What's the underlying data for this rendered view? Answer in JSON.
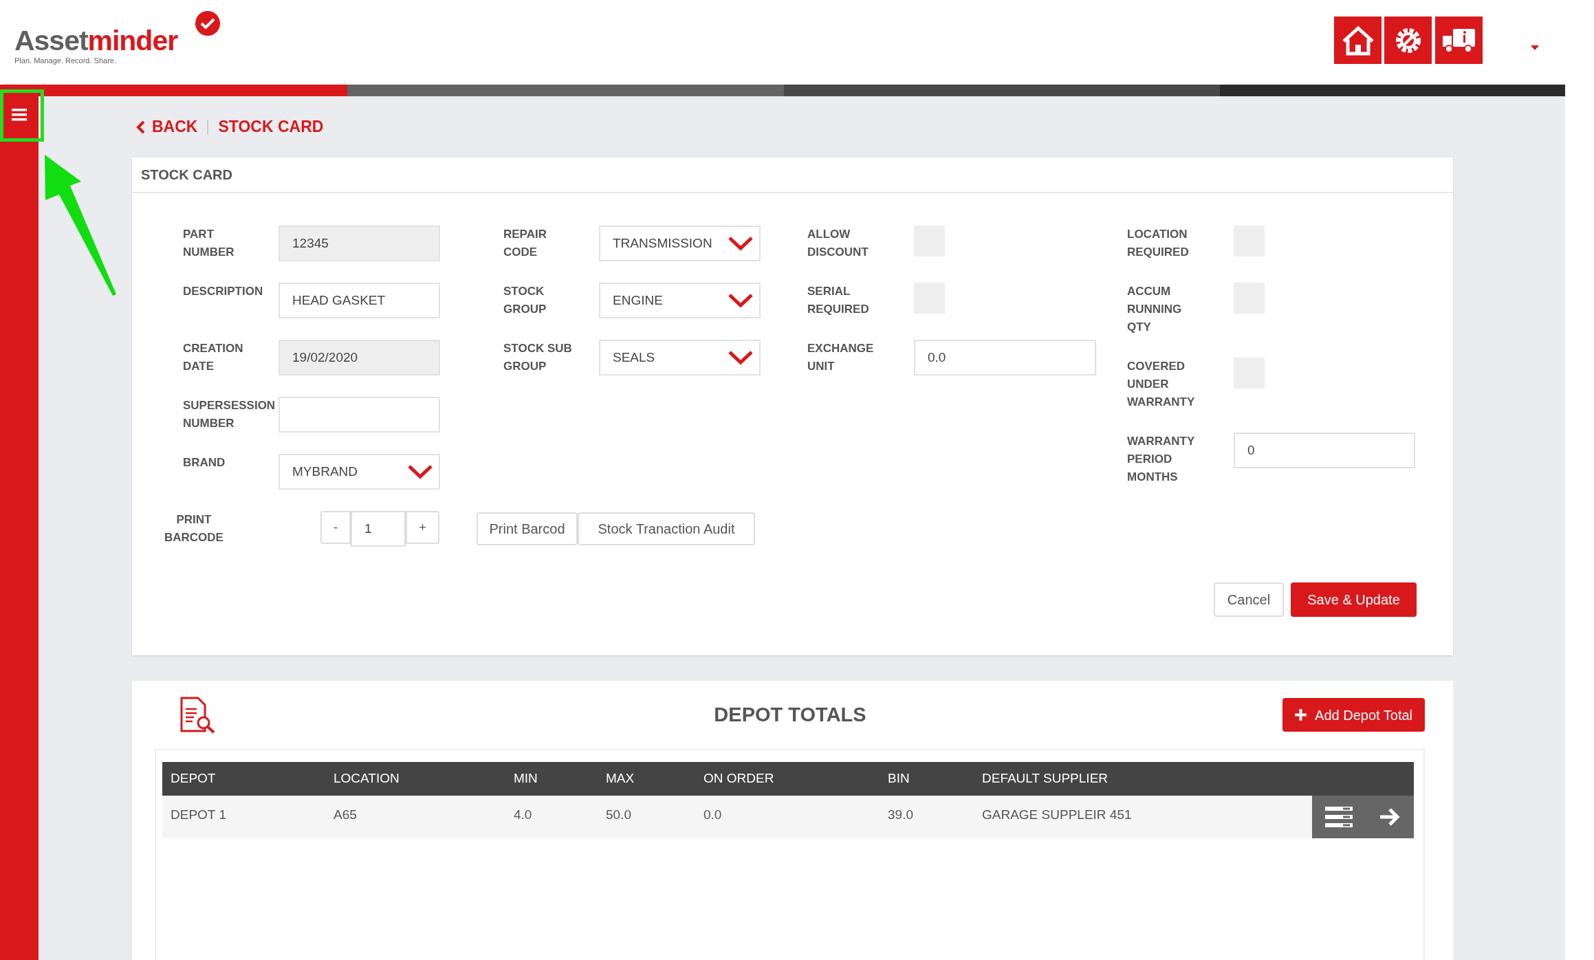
{
  "header": {
    "logo": {
      "part_1": "Asset",
      "part_2": "minder",
      "tagline": "Plan. Manage. Record. Share."
    }
  },
  "breadcrumb": {
    "back": "BACK",
    "current": "STOCK CARD"
  },
  "stock_card": {
    "title": "STOCK CARD",
    "columns": [
      {
        "fields": [
          {
            "kind": "input",
            "label": "PART\nNUMBER",
            "value": "12345",
            "disabled": true
          },
          {
            "kind": "input",
            "label": "DESCRIPTION",
            "value": "HEAD GASKET",
            "disabled": false
          },
          {
            "kind": "input",
            "label": "CREATION\nDATE",
            "value": "19/02/2020",
            "disabled": true
          },
          {
            "kind": "input",
            "label": "SUPERSESSION\nNUMBER",
            "disabled": false
          },
          {
            "kind": "select",
            "label": "BRAND",
            "value": "MYBRAND"
          }
        ]
      },
      {
        "fields": [
          {
            "kind": "select",
            "label": "REPAIR\nCODE",
            "value": "TRANSMISSION"
          },
          {
            "kind": "select",
            "label": "STOCK\nGROUP",
            "value": "ENGINE"
          },
          {
            "kind": "select",
            "label": "STOCK SUB\nGROUP",
            "value": "SEALS"
          }
        ]
      },
      {
        "fields": [
          {
            "kind": "checkbox",
            "label": "ALLOW\nDISCOUNT",
            "checked": false
          },
          {
            "kind": "checkbox",
            "label": "SERIAL\nREQUIRED",
            "checked": false
          },
          {
            "kind": "input",
            "label": "EXCHANGE\nUNIT",
            "value": "0.0",
            "disabled": false
          }
        ]
      },
      {
        "fields": [
          {
            "kind": "checkbox",
            "label": "LOCATION\nREQUIRED",
            "checked": false
          },
          {
            "kind": "checkbox",
            "label": "ACCUM\nRUNNING\nQTY",
            "checked": false
          },
          {
            "kind": "checkbox",
            "label": "COVERED\nUNDER\nWARRANTY",
            "checked": false
          },
          {
            "kind": "input",
            "label": "WARRANTY\nPERIOD\nMONTHS",
            "value": "0",
            "disabled": false
          }
        ]
      }
    ],
    "print_barcode": {
      "label": "PRINT\nBARCODE",
      "decrement": "-",
      "quantity": "1",
      "increment": "+"
    },
    "buttons": [
      "Print Barcod",
      "Stock Tranaction Audit"
    ],
    "actions": [
      {
        "kind": "secondary",
        "label": "Cancel"
      },
      {
        "kind": "primary",
        "label": "Save & Update"
      }
    ]
  },
  "depot_totals": {
    "title": "DEPOT TOTALS",
    "add_button": "Add Depot Total",
    "columns": [
      "DEPOT",
      "LOCATION",
      "MIN",
      "MAX",
      "ON ORDER",
      "BIN",
      "DEFAULT SUPPLIER"
    ],
    "rows": [
      [
        "DEPOT 1",
        "A65",
        "4.0",
        "50.0",
        "0.0",
        "39.0",
        "GARAGE SUPPLEIR 451"
      ]
    ]
  }
}
